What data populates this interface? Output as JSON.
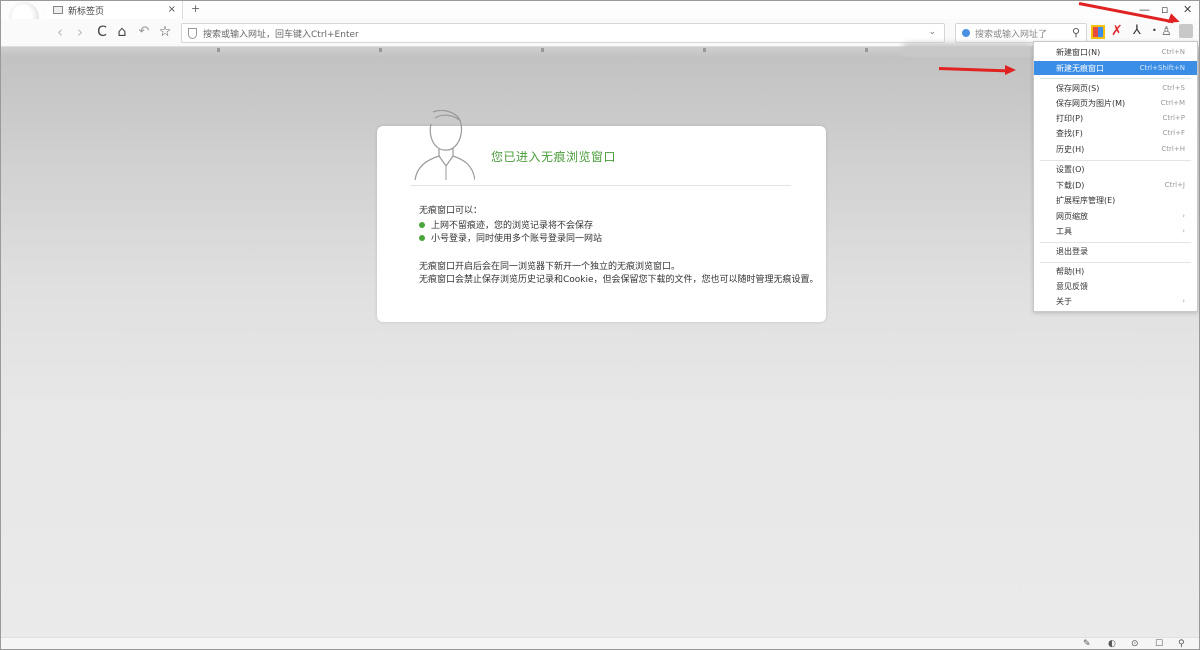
{
  "browser": {
    "tab_title": "新标签页",
    "tab_close": "×",
    "new_tab": "+",
    "window_controls": {
      "minimize": "—",
      "restore": "▫",
      "close": "✕"
    },
    "address_text": "搜索或输入网址，回车键入Ctrl+Enter",
    "search_placeholder": "搜索或输入网址了",
    "nav": {
      "back": "‹",
      "forward": "›",
      "reload": "C",
      "home": "⌂",
      "undo": "↶",
      "favorite": "☆"
    },
    "extensions": {
      "red": "✗",
      "user": "⅄",
      "bullet": "•",
      "person": "♙"
    },
    "dropdown_arrow": "⌄",
    "search_icon": "⚲"
  },
  "incognito_card": {
    "title": "您已进入无痕浏览窗口",
    "intro": "无痕窗口可以：",
    "bullets": [
      "上网不留痕迹，您的浏览记录将不会保存",
      "小号登录，同时使用多个账号登录同一网站"
    ],
    "paragraph_1": "无痕窗口开启后会在同一浏览器下新开一个独立的无痕浏览窗口。",
    "paragraph_2": "无痕窗口会禁止保存浏览历史记录和Cookie，但会保留您下载的文件，您也可以随时管理无痕设置。"
  },
  "menu": {
    "items": [
      {
        "label": "新建窗口(N)",
        "shortcut": "Ctrl+N"
      },
      {
        "label": "新建无痕窗口",
        "shortcut": "Ctrl+Shift+N"
      },
      {
        "label": "保存网页(S)",
        "shortcut": "Ctrl+S"
      },
      {
        "label": "保存网页为图片(M)",
        "shortcut": "Ctrl+M"
      },
      {
        "label": "打印(P)",
        "shortcut": "Ctrl+P"
      },
      {
        "label": "查找(F)",
        "shortcut": "Ctrl+F"
      },
      {
        "label": "历史(H)",
        "shortcut": "Ctrl+H"
      },
      {
        "label": "设置(O)",
        "shortcut": ""
      },
      {
        "label": "下载(D)",
        "shortcut": "Ctrl+J"
      },
      {
        "label": "扩展程序管理(E)",
        "shortcut": ""
      },
      {
        "label": "网页缩放",
        "shortcut": "›"
      },
      {
        "label": "工具",
        "shortcut": "›"
      },
      {
        "label": "退出登录",
        "shortcut": ""
      },
      {
        "label": "帮助(H)",
        "shortcut": ""
      },
      {
        "label": "意见反馈",
        "shortcut": ""
      },
      {
        "label": "关于",
        "shortcut": "›"
      }
    ]
  },
  "statusbar": {
    "icons": [
      "✎",
      "◐",
      "⊙",
      "☐",
      "⚲"
    ]
  },
  "colors": {
    "accent_green": "#4a9c3a",
    "menu_highlight": "#3a8ee6",
    "annotation_red": "#e02222"
  }
}
